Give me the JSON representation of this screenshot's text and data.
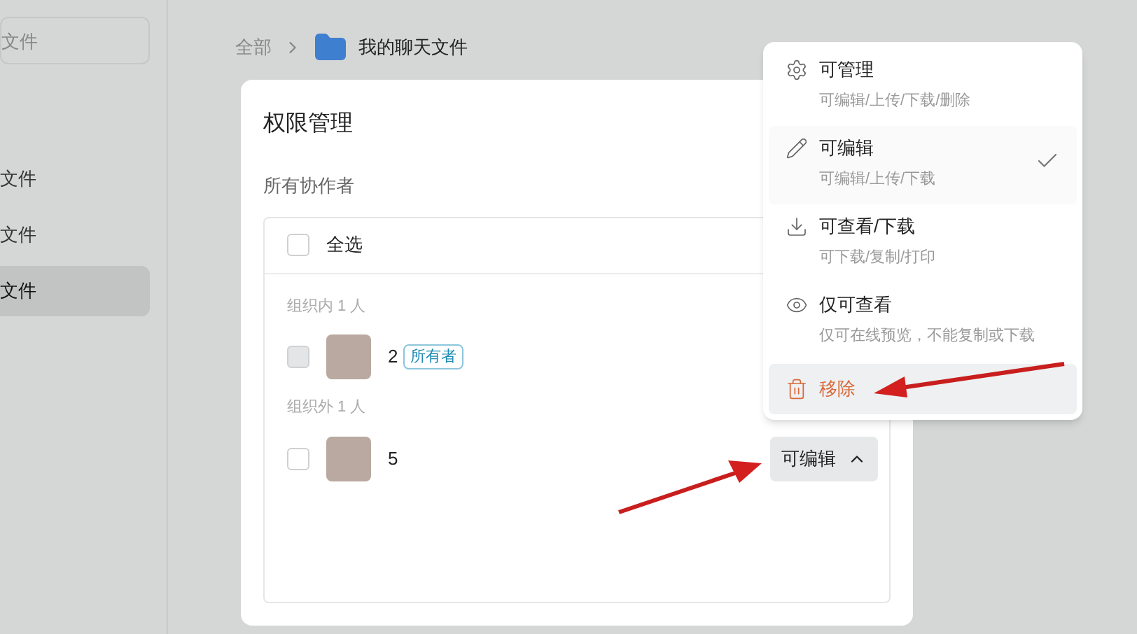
{
  "sidebar": {
    "search": {
      "placeholder": "文件"
    },
    "items": [
      {
        "label": "文件",
        "selected": false
      },
      {
        "label": "文件",
        "selected": false
      },
      {
        "label": "文件",
        "selected": true
      }
    ]
  },
  "breadcrumb": {
    "root": "全部",
    "current": "我的聊天文件"
  },
  "dialog": {
    "title": "权限管理",
    "section": "所有协作者",
    "select_all": {
      "label": "全选",
      "checked": false
    },
    "groups": [
      {
        "label": "组织内 1 人",
        "members": [
          {
            "name": "2",
            "badge": "所有者",
            "checked": false,
            "disabled": true
          }
        ]
      },
      {
        "label": "组织外 1 人",
        "members": [
          {
            "name": "5",
            "checked": false,
            "disabled": false,
            "permission": "可编辑",
            "expanded": true
          }
        ]
      }
    ]
  },
  "menu": {
    "items": [
      {
        "kind": "option",
        "label": "可管理",
        "description": "可编辑/上传/下载/删除",
        "selected": false
      },
      {
        "kind": "option",
        "label": "可编辑",
        "description": "可编辑/上传/下载",
        "selected": true
      },
      {
        "kind": "option",
        "label": "可查看/下载",
        "description": "可下载/复制/打印",
        "selected": false
      },
      {
        "kind": "option",
        "label": "仅可查看",
        "description": "仅可在线预览，不能复制或下载",
        "selected": false
      },
      {
        "kind": "danger",
        "label": "移除",
        "selected": false
      }
    ]
  }
}
